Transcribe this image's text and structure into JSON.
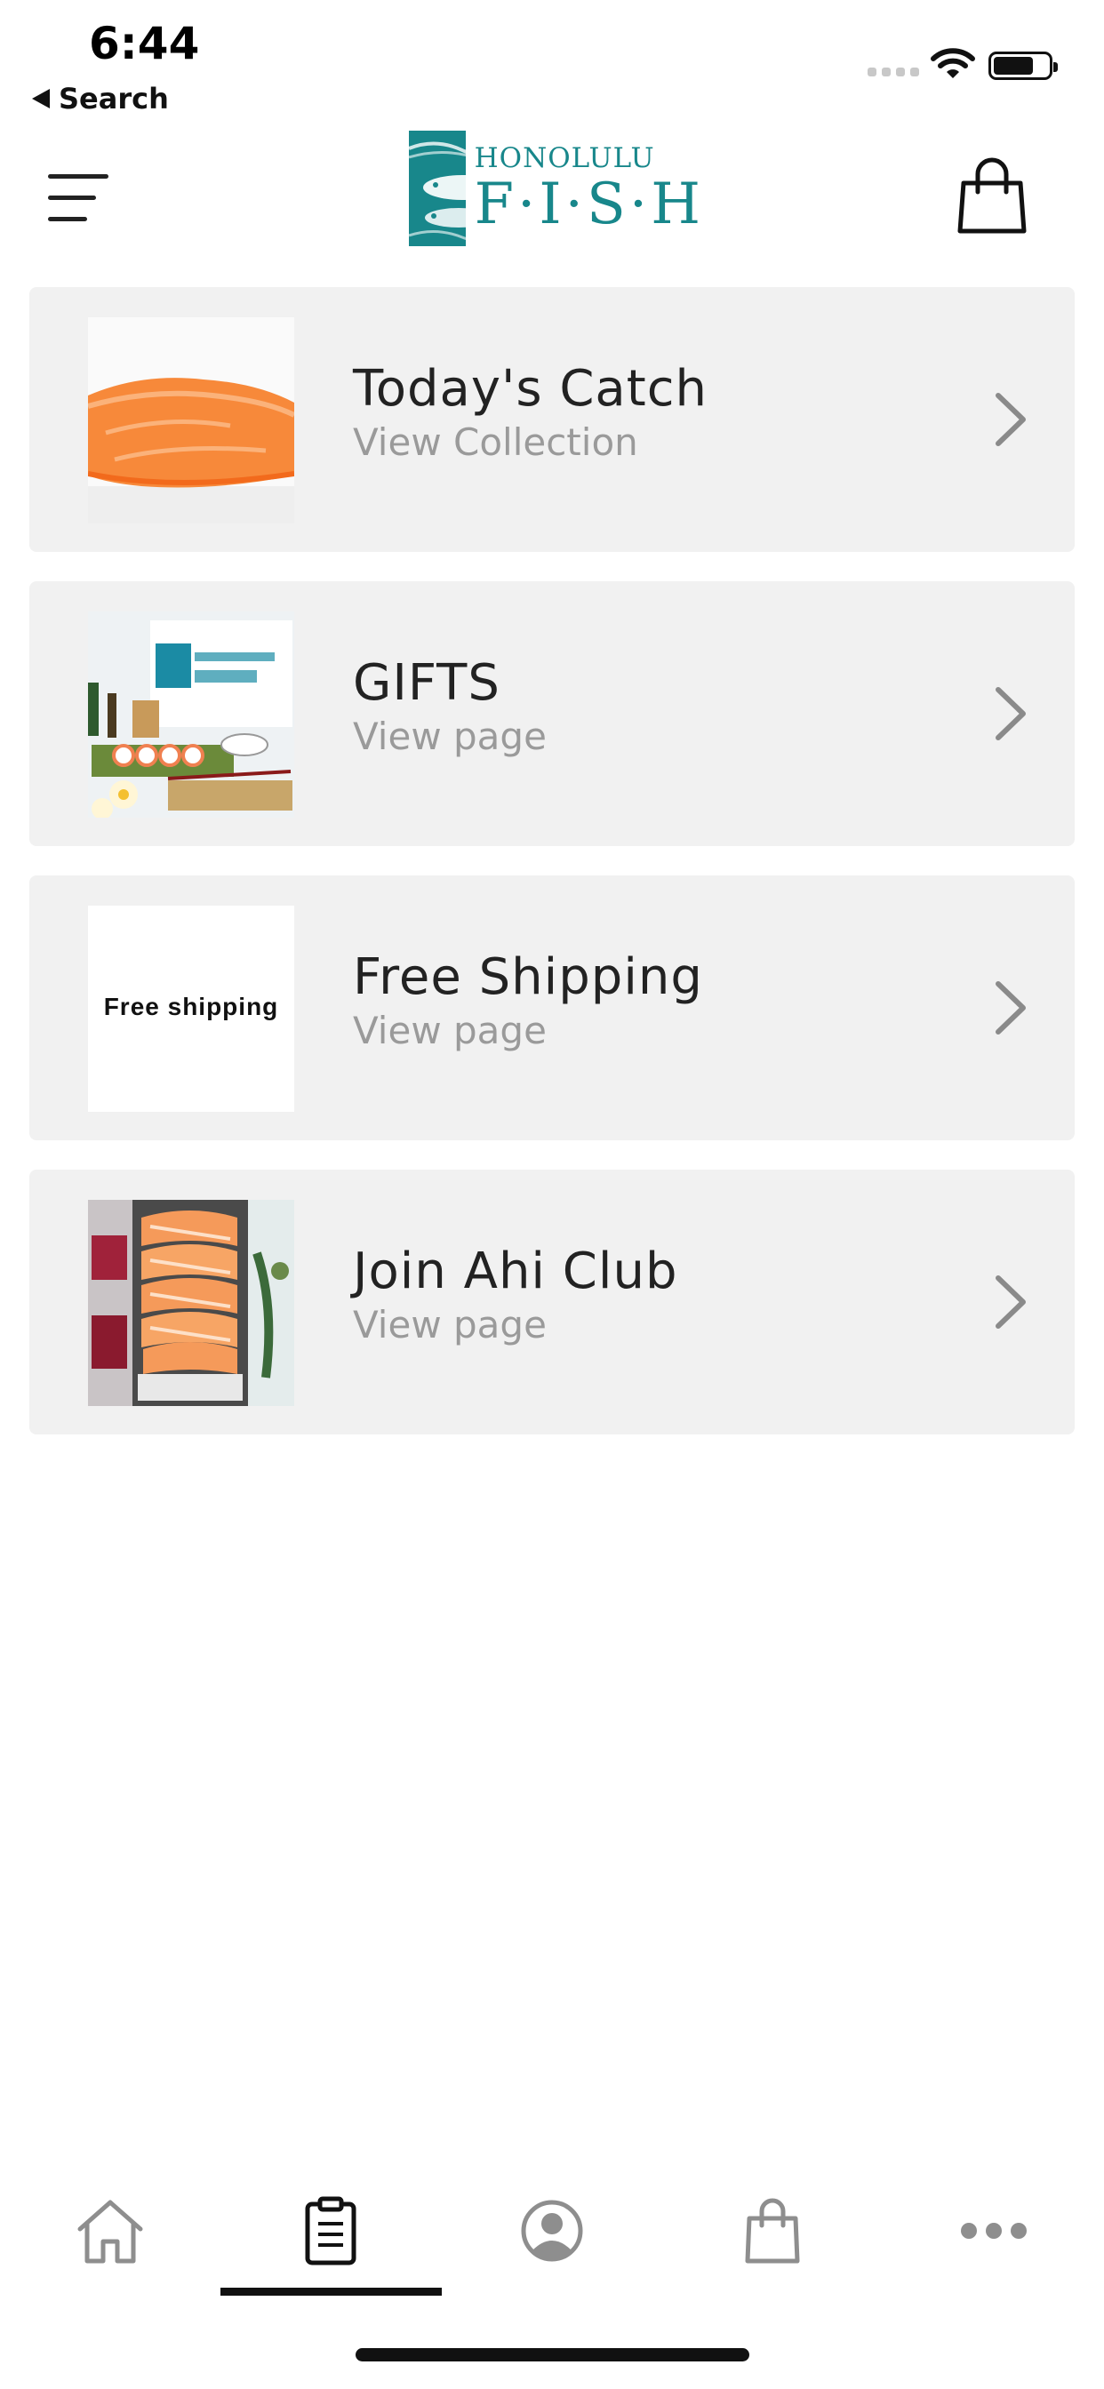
{
  "status_bar": {
    "time": "6:44",
    "back_label": "Search",
    "icons": [
      "cellular-signal-icon",
      "wifi-icon",
      "battery-icon"
    ]
  },
  "header": {
    "menu_icon": "hamburger-menu-icon",
    "logo": {
      "line1": "HONOLULU",
      "line2": "F·I·S·H"
    },
    "cart_icon": "shopping-bag-icon",
    "brand_color": "#18878b"
  },
  "list": {
    "items": [
      {
        "title": "Today's Catch",
        "subtitle": "View Collection",
        "thumb": "salmon-fillet-image",
        "chevron": "chevron-right-icon"
      },
      {
        "title": "GIFTS",
        "subtitle": "View page",
        "thumb": "gift-set-image",
        "chevron": "chevron-right-icon"
      },
      {
        "title": "Free Shipping",
        "subtitle": "View page",
        "thumb_text": "Free shipping",
        "chevron": "chevron-right-icon"
      },
      {
        "title": "Join Ahi Club",
        "subtitle": "View page",
        "thumb": "sashimi-image",
        "chevron": "chevron-right-icon"
      }
    ],
    "card_color": "#f1f1f1",
    "subtitle_color": "#9a9a9a"
  },
  "tab_bar": {
    "tabs": [
      {
        "icon": "home-icon",
        "active": false
      },
      {
        "icon": "clipboard-icon",
        "active": true
      },
      {
        "icon": "account-icon",
        "active": false
      },
      {
        "icon": "shopping-bag-icon",
        "active": false
      },
      {
        "icon": "more-icon",
        "active": false
      }
    ],
    "inactive_color": "#8e8e8e",
    "active_color": "#111111"
  }
}
